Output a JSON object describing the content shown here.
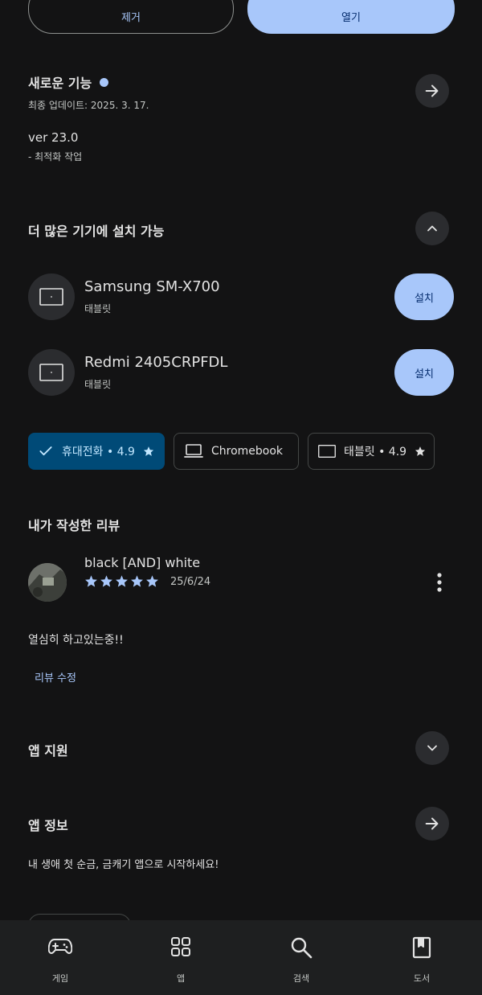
{
  "top_buttons": {
    "remove": "제거",
    "open": "열기"
  },
  "whats_new": {
    "title": "새로운 기능",
    "updated": "최종 업데이트: 2025. 3. 17.",
    "version": "ver 23.0",
    "note": "- 최적화 작업"
  },
  "more_devices": {
    "title": "더 많은 기기에 설치 가능",
    "devices": [
      {
        "name": "Samsung SM-X700",
        "type": "태블릿",
        "install": "설치"
      },
      {
        "name": "Redmi 2405CRPFDL",
        "type": "태블릿",
        "install": "설치"
      }
    ]
  },
  "chips": {
    "phone": "휴대전화 • 4.9",
    "chromebook": "Chromebook",
    "tablet": "태블릿 • 4.9"
  },
  "my_review": {
    "title": "내가 작성한 리뷰",
    "author": "black [AND] white",
    "stars": 5,
    "date": "25/6/24",
    "text": "열심히 하고있는중!!",
    "edit": "리뷰 수정"
  },
  "app_support": {
    "title": "앱 지원"
  },
  "app_info": {
    "title": "앱 정보",
    "desc": "내 생애 첫 순금, 금캐기 앱으로 시작하세요!"
  },
  "bottom_nav": [
    {
      "label": "게임",
      "icon": "gamepad-icon"
    },
    {
      "label": "앱",
      "icon": "apps-grid-icon"
    },
    {
      "label": "검색",
      "icon": "search-icon"
    },
    {
      "label": "도서",
      "icon": "book-icon"
    }
  ],
  "colors": {
    "background": "#131314",
    "accent": "#a8c7fa",
    "chip_selected": "#004a77",
    "star": "#a8c7fa"
  }
}
